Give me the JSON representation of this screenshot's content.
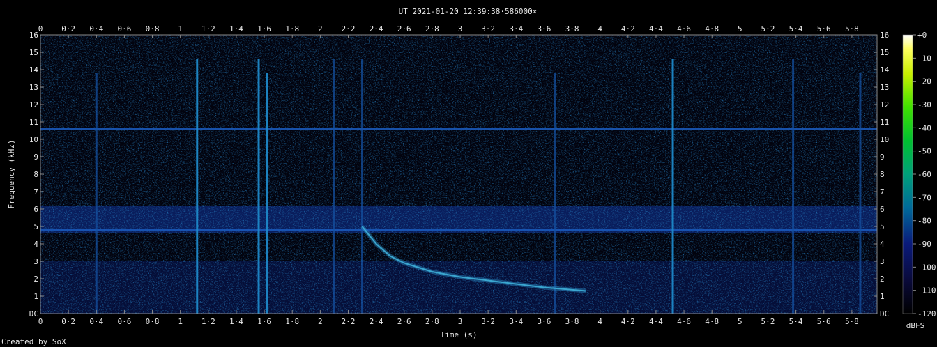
{
  "title": "UT 2021-01-20 12:39:38·586000×",
  "credit": "Created by SoX",
  "colors": {
    "background": "#000000",
    "axis": "#8a8a8a",
    "text": "#e8e8e8"
  },
  "chart_data": {
    "type": "heatmap",
    "title": "UT 2021-01-20 12:39:38·586000×",
    "xlabel": "Time (s)",
    "ylabel": "Frequency (kHz)",
    "xlim": [
      0,
      5.98
    ],
    "ylim": [
      0,
      16
    ],
    "x_ticks": [
      0,
      0.2,
      0.4,
      0.6,
      0.8,
      1,
      1.2,
      1.4,
      1.6,
      1.8,
      2,
      2.2,
      2.4,
      2.6,
      2.8,
      3,
      3.2,
      3.4,
      3.6,
      3.8,
      4,
      4.2,
      4.4,
      4.6,
      4.8,
      5,
      5.2,
      5.4,
      5.6,
      5.8
    ],
    "x_tick_labels": [
      "0",
      "0·2",
      "0·4",
      "0·6",
      "0·8",
      "1",
      "1·2",
      "1·4",
      "1·6",
      "1·8",
      "2",
      "2·2",
      "2·4",
      "2·6",
      "2·8",
      "3",
      "3·2",
      "3·4",
      "3·6",
      "3·8",
      "4",
      "4·2",
      "4·4",
      "4·6",
      "4·8",
      "5",
      "5·2",
      "5·4",
      "5·6",
      "5·8"
    ],
    "y_ticks": [
      0,
      1,
      2,
      3,
      4,
      5,
      6,
      7,
      8,
      9,
      10,
      11,
      12,
      13,
      14,
      15,
      16
    ],
    "y_tick_labels": [
      "DC",
      "1",
      "2",
      "3",
      "4",
      "5",
      "6",
      "7",
      "8",
      "9",
      "10",
      "11",
      "12",
      "13",
      "14",
      "15",
      "16"
    ],
    "colorbar": {
      "label": "dBFS",
      "range": [
        -120,
        0
      ],
      "ticks": [
        0,
        -10,
        -20,
        -30,
        -40,
        -50,
        -60,
        -70,
        -80,
        -90,
        -100,
        -110,
        -120
      ],
      "tick_labels": [
        "+0",
        "-10",
        "-20",
        "-30",
        "-40",
        "-50",
        "-60",
        "-70",
        "-80",
        "-90",
        "-100",
        "-110",
        "-120"
      ]
    },
    "features": {
      "noise_band_khz": [
        4.6,
        6.2
      ],
      "tone_lines_khz": [
        4.8,
        10.6
      ],
      "impulses_s": [
        0.4,
        1.12,
        1.56,
        1.62,
        2.1,
        2.3,
        3.68,
        4.52,
        5.38,
        5.86
      ],
      "whistler": {
        "start_s": 2.3,
        "start_khz": 5.0,
        "points": [
          [
            2.3,
            5.0
          ],
          [
            2.4,
            4.0
          ],
          [
            2.5,
            3.3
          ],
          [
            2.6,
            2.9
          ],
          [
            2.8,
            2.4
          ],
          [
            3.0,
            2.1
          ],
          [
            3.3,
            1.8
          ],
          [
            3.6,
            1.5
          ],
          [
            3.9,
            1.3
          ]
        ]
      }
    }
  }
}
